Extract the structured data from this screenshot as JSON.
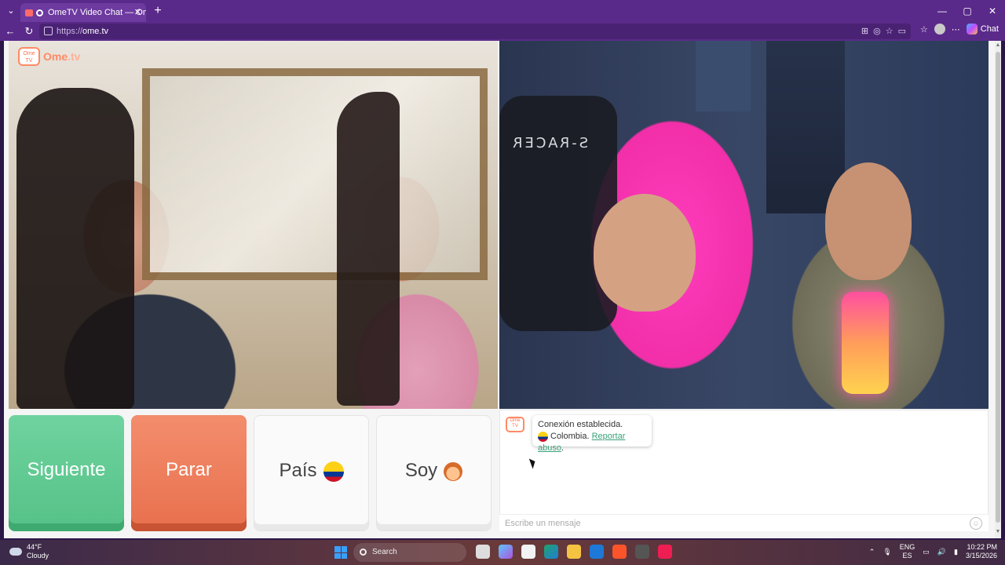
{
  "browser": {
    "tab_title": "OmeTV Video Chat — Omegle",
    "tab_close": "✕",
    "new_tab": "+",
    "url_prefix": "https://",
    "url_host": "ome.tv",
    "copilot_label": "Chat",
    "window_controls": [
      "—",
      "▢",
      "✕"
    ]
  },
  "site": {
    "logo_icon_text": "Ome TV",
    "logo_text_main": "Ome",
    "logo_text_suffix": ".tv"
  },
  "remote_video": {
    "overlay_text": "S-RACER"
  },
  "controls": {
    "next_label": "Siguiente",
    "stop_label": "Parar",
    "country_label": "País",
    "gender_label": "Soy"
  },
  "chat": {
    "system_icon_text": "Ome TV",
    "status_line": "Conexión establecida.",
    "country": "Colombia.",
    "report_link": "Reportar abuso",
    "report_suffix": ".",
    "input_placeholder": "Escribe un mensaje"
  },
  "taskbar": {
    "temperature": "44°F",
    "condition": "Cloudy",
    "search_label": "Search",
    "lang_top": "ENG",
    "lang_bottom": "ES",
    "time": "10:22 PM",
    "date": "3/15/2026"
  },
  "colors": {
    "accent_purple": "#5a2a8a",
    "next_green": "#55c187",
    "stop_orange": "#e8704e",
    "brand_orange": "#ff8a65",
    "link_green": "#3aa17a"
  }
}
